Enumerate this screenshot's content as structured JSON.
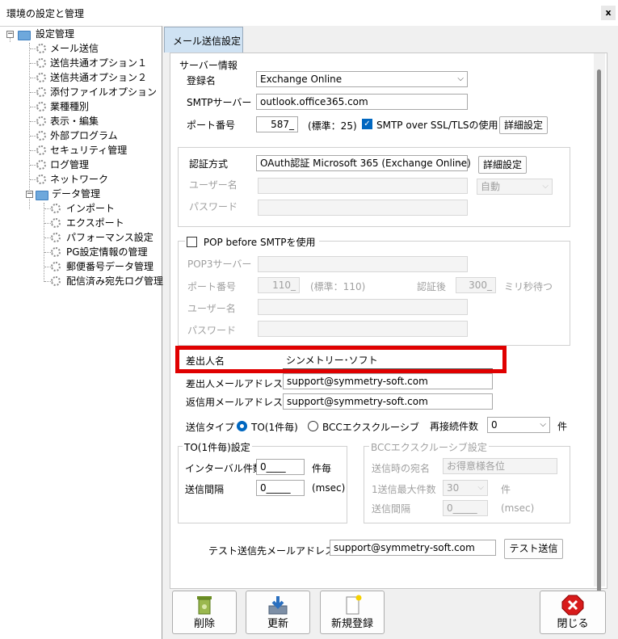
{
  "window": {
    "title": "環境の設定と管理",
    "close": "x"
  },
  "tree": {
    "root": "設定管理",
    "items": [
      "メール送信",
      "送信共通オプション１",
      "送信共通オプション２",
      "添付ファイルオプション",
      "業種種別",
      "表示・編集",
      "外部プログラム",
      "セキュリティ管理",
      "ログ管理",
      "ネットワーク"
    ],
    "data_folder": "データ管理",
    "data_items": [
      "インポート",
      "エクスポート",
      "パフォーマンス設定",
      "PG設定情報の管理",
      "郵便番号データ管理",
      "配信済み宛先ログ管理"
    ]
  },
  "tab": {
    "label": "メール送信設定"
  },
  "server": {
    "legend": "サーバー情報",
    "reg_label": "登録名",
    "reg_value": "Exchange Online",
    "smtp_label": "SMTPサーバー",
    "smtp_value": "outlook.office365.com",
    "port_label": "ポート番号",
    "port_value": "587_",
    "port_std": "(標準：25)",
    "ssl_label": "SMTP over SSL/TLSの使用",
    "detail_btn": "詳細設定"
  },
  "auth": {
    "method_label": "認証方式",
    "method_value": "OAuth認証 Microsoft 365 (Exchange Online)",
    "detail_btn": "詳細設定",
    "user_label": "ユーザー名",
    "user_mode": "自動",
    "pass_label": "パスワード"
  },
  "pop": {
    "check_label": "POP before SMTPを使用",
    "server_label": "POP3サーバー",
    "port_label": "ポート番号",
    "port_value": "110_",
    "port_std": "(標準：110)",
    "after_label": "認証後",
    "wait_value": "300_",
    "wait_unit": "ミリ秒待つ",
    "user_label": "ユーザー名",
    "pass_label": "パスワード"
  },
  "sender": {
    "name_label": "差出人名",
    "name_value": "シンメトリー･ソフト",
    "mail_label": "差出人メールアドレス",
    "mail_value": "support@symmetry-soft.com",
    "reply_label": "返信用メールアドレス",
    "reply_value": "support@symmetry-soft.com"
  },
  "send_type": {
    "label": "送信タイプ",
    "to_label": "TO(1件毎)",
    "bcc_label": "BCCエクスクルーシブ",
    "retry_label": "再接続件数",
    "retry_value": "0",
    "retry_unit": "件"
  },
  "to_group": {
    "legend": "TO(1件毎)設定",
    "interval_count_label": "インターバル件数",
    "interval_count_value": "0____",
    "interval_count_unit": "件毎",
    "interval_label": "送信間隔",
    "interval_value": "0_____",
    "interval_unit": "(msec)"
  },
  "bcc_group": {
    "legend": "BCCエクスクルーシブ設定",
    "dest_label": "送信時の宛名",
    "dest_value": "お得意様各位",
    "max_label": "1送信最大件数",
    "max_value": "30",
    "max_unit": "件",
    "interval_label": "送信間隔",
    "interval_value": "0_____",
    "interval_unit": "(msec)"
  },
  "test": {
    "label": "テスト送信先メールアドレス",
    "value": "support@symmetry-soft.com",
    "button": "テスト送信"
  },
  "footer": {
    "delete": "削除",
    "update": "更新",
    "new": "新規登録",
    "close": "閉じる"
  },
  "colors": {
    "accent": "#0067c0",
    "highlight": "#e00000",
    "tab_bg": "#cfe2f3",
    "folder": "#6ea8dc"
  }
}
